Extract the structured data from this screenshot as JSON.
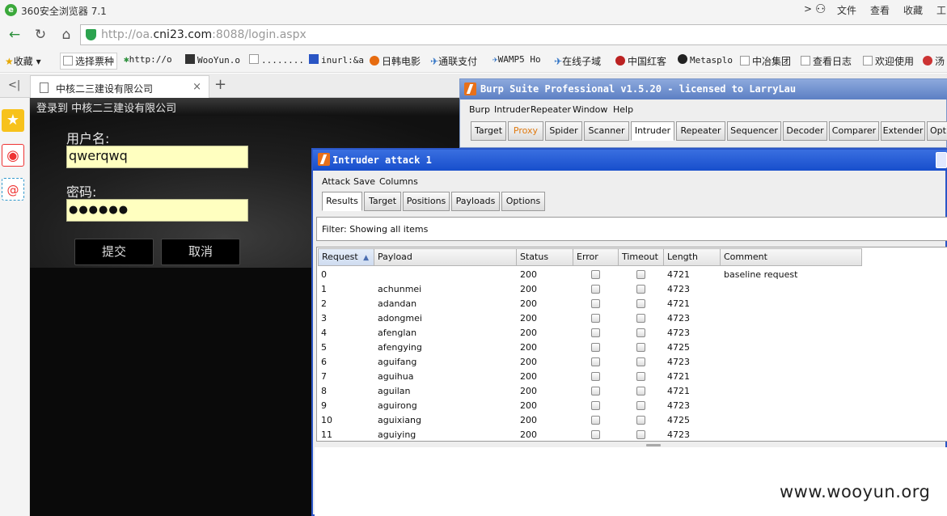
{
  "browser": {
    "title": "360安全浏览器 7.1",
    "menu": [
      "文件",
      "查看",
      "收藏",
      "工"
    ],
    "url_prefix": "http://oa.",
    "url_domain": "cni23.com",
    "url_suffix": ":8088/login.aspx",
    "bookmarks": [
      "收藏",
      "选择票种",
      "http://o",
      "WooYun.o",
      "........",
      "inurl:&a",
      "日韩电影",
      "通联支付",
      "WAMP5 Ho",
      "在线子域",
      "中国红客",
      "Metasplo",
      "中冶集团",
      "查看日志",
      "欢迎使用",
      "汤"
    ],
    "tab_title": "中核二三建设有限公司",
    "tab_close": "×",
    "new_tab": "+",
    "tab_back": "<|"
  },
  "login_page": {
    "header": "登录到 中核二三建设有限公司",
    "username_label": "用户名:",
    "username_value": "qwerqwq",
    "password_label": "密码:",
    "password_value": "●●●●●●",
    "submit_label": "提交",
    "cancel_label": "取消"
  },
  "burp": {
    "title": "Burp Suite Professional v1.5.20 - licensed to LarryLau",
    "menu": [
      "Burp",
      "Intruder",
      "Repeater",
      "Window",
      "Help"
    ],
    "tabs": [
      "Target",
      "Proxy",
      "Spider",
      "Scanner",
      "Intruder",
      "Repeater",
      "Sequencer",
      "Decoder",
      "Comparer",
      "Extender",
      "Opt"
    ],
    "selected_tab": "Intruder"
  },
  "intruder": {
    "title": "Intruder attack 1",
    "menu": [
      "Attack",
      "Save",
      "Columns"
    ],
    "tabs": [
      "Results",
      "Target",
      "Positions",
      "Payloads",
      "Options"
    ],
    "selected_tab": "Results",
    "filter_text": "Filter:  Showing all items",
    "sort_arrow": "▲",
    "columns": [
      "Request",
      "Payload",
      "Status",
      "Error",
      "Timeout",
      "Length",
      "Comment"
    ],
    "rows": [
      {
        "request": "0",
        "payload": "",
        "status": "200",
        "length": "4721",
        "comment": "baseline request"
      },
      {
        "request": "1",
        "payload": "achunmei",
        "status": "200",
        "length": "4723",
        "comment": ""
      },
      {
        "request": "2",
        "payload": "adandan",
        "status": "200",
        "length": "4721",
        "comment": ""
      },
      {
        "request": "3",
        "payload": "adongmei",
        "status": "200",
        "length": "4723",
        "comment": ""
      },
      {
        "request": "4",
        "payload": "afenglan",
        "status": "200",
        "length": "4723",
        "comment": ""
      },
      {
        "request": "5",
        "payload": "afengying",
        "status": "200",
        "length": "4725",
        "comment": ""
      },
      {
        "request": "6",
        "payload": "aguifang",
        "status": "200",
        "length": "4723",
        "comment": ""
      },
      {
        "request": "7",
        "payload": "aguihua",
        "status": "200",
        "length": "4721",
        "comment": ""
      },
      {
        "request": "8",
        "payload": "aguilan",
        "status": "200",
        "length": "4721",
        "comment": ""
      },
      {
        "request": "9",
        "payload": "aguirong",
        "status": "200",
        "length": "4723",
        "comment": ""
      },
      {
        "request": "10",
        "payload": "aguixiang",
        "status": "200",
        "length": "4725",
        "comment": ""
      },
      {
        "request": "11",
        "payload": "aguiying",
        "status": "200",
        "length": "4723",
        "comment": ""
      }
    ]
  },
  "watermark": "www.wooyun.org"
}
